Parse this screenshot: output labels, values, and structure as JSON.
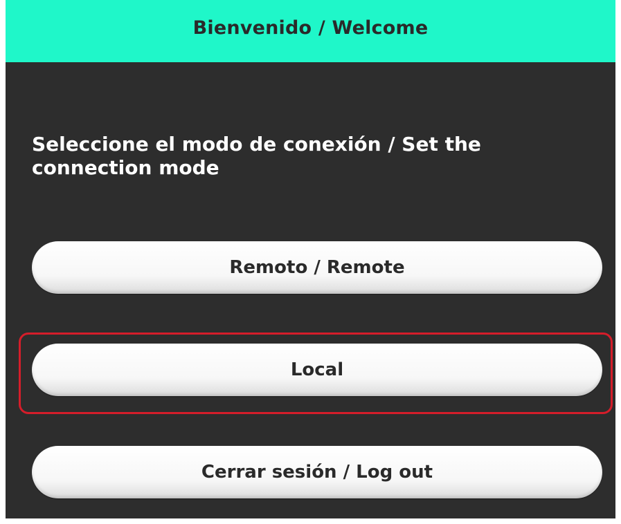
{
  "header": {
    "title": "Bienvenido / Welcome"
  },
  "prompt": {
    "text": "Seleccione el modo de conexión / Set the connection mode"
  },
  "buttons": {
    "remote": "Remoto / Remote",
    "local": "Local",
    "logout": "Cerrar sesión / Log out"
  },
  "colors": {
    "header": "#1ff7c9",
    "background": "#2d2d2d",
    "highlight": "#d51d2a"
  }
}
